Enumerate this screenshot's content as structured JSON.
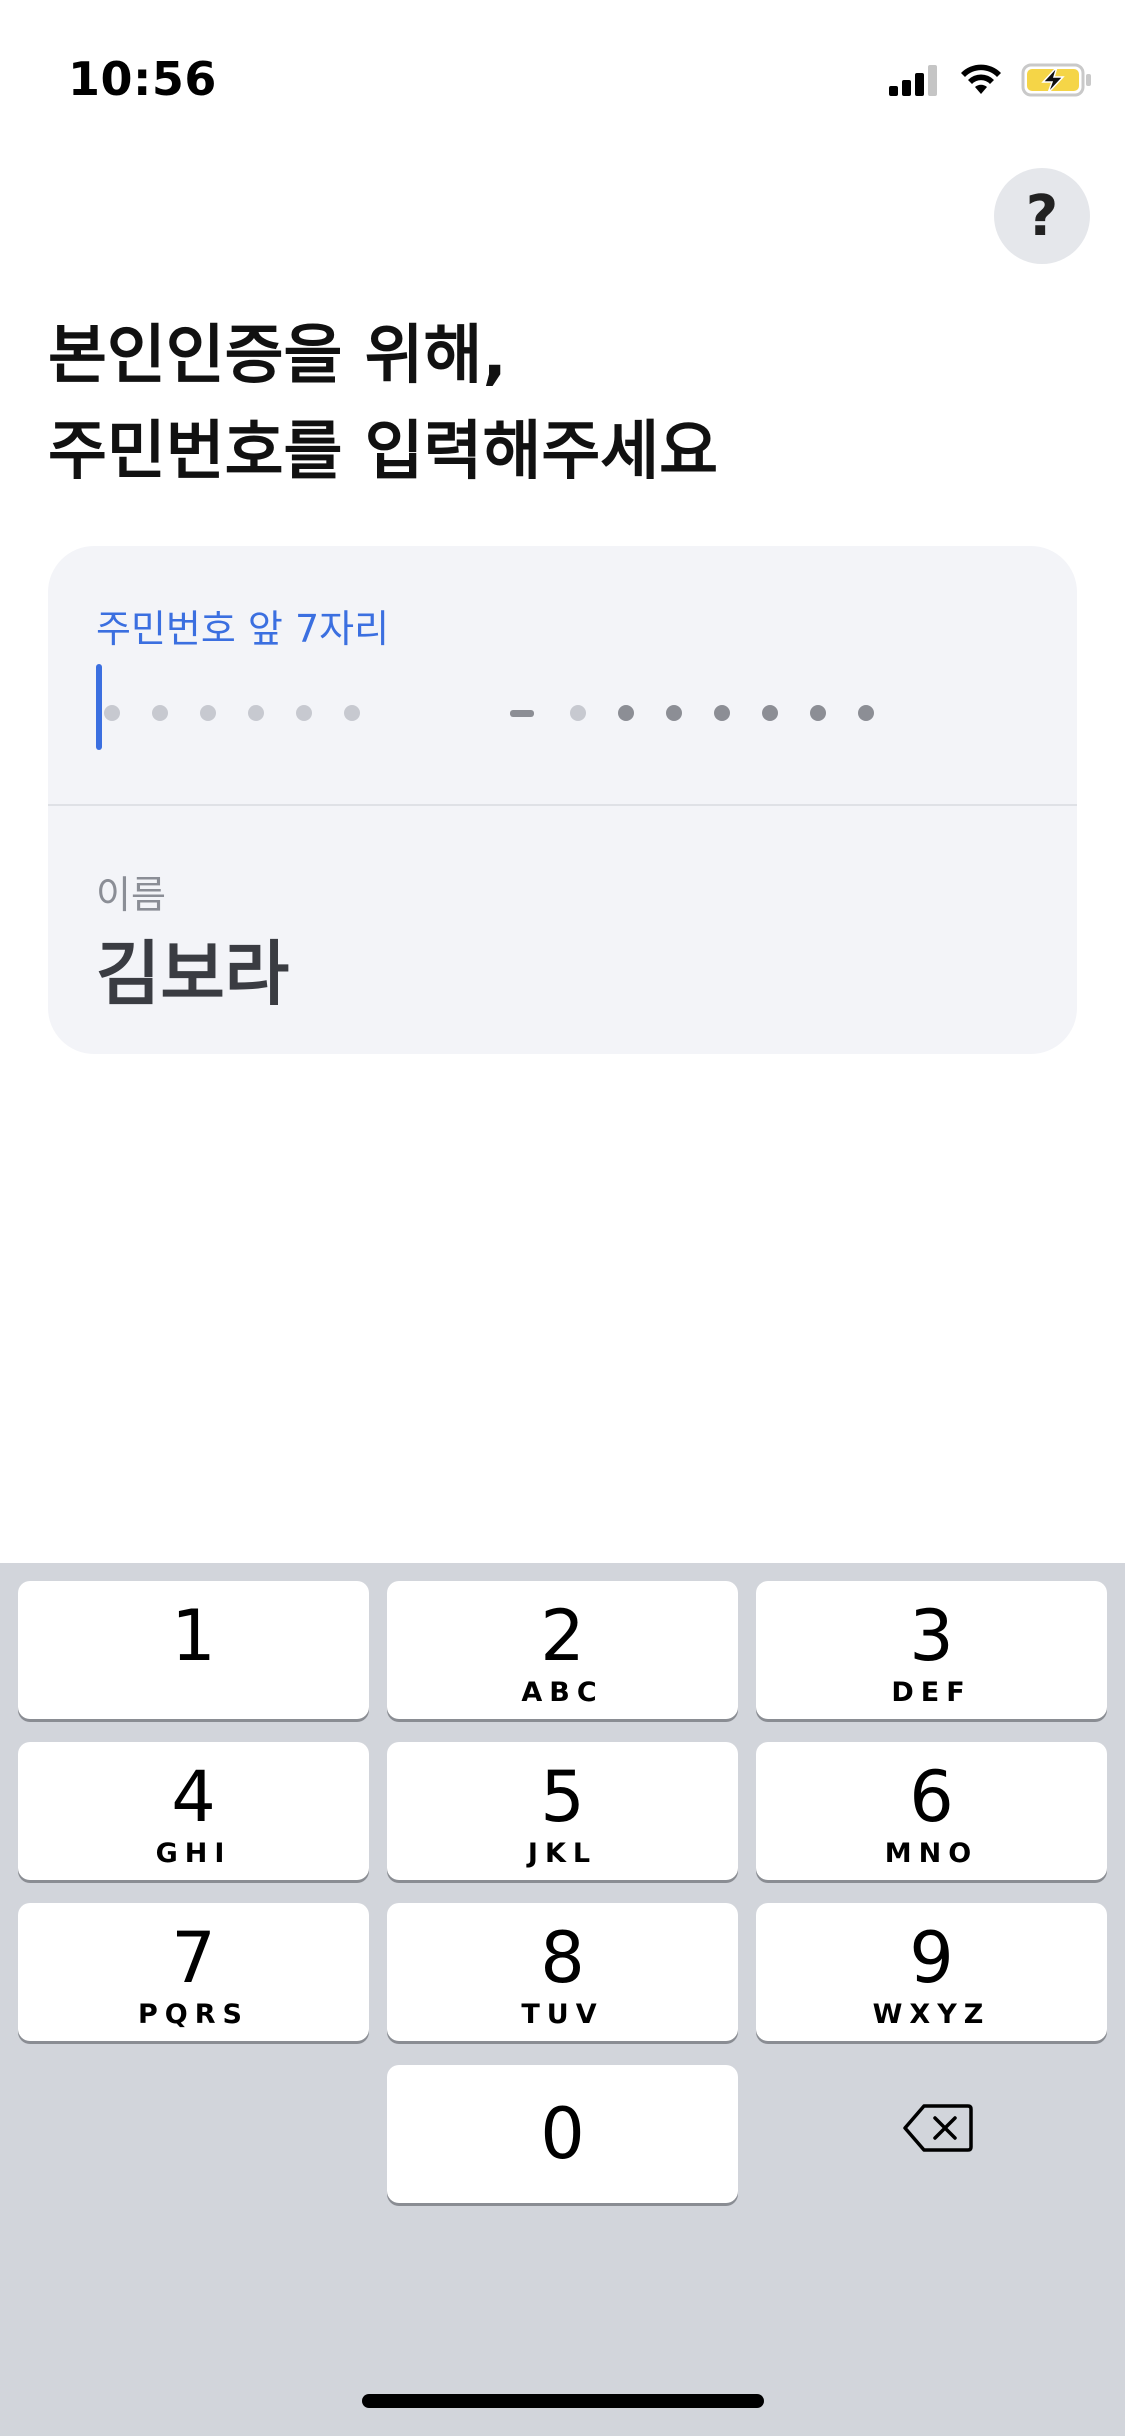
{
  "status_bar": {
    "time": "10:56",
    "icons": [
      "cellular-signal-icon",
      "wifi-icon",
      "battery-charging-icon"
    ]
  },
  "help_button": {
    "label": "?"
  },
  "title": {
    "line1": "본인인증을 위해,",
    "line2": "주민번호를 입력해주세요"
  },
  "rrn_field": {
    "label": "주민번호 앞 7자리",
    "front_digits_entered": 0,
    "front_digits_total": 6,
    "back_digits_total": 7,
    "back_digits_masked_filled": 6
  },
  "name_field": {
    "label": "이름",
    "value": "김보라"
  },
  "keyboard": {
    "keys": [
      {
        "digit": "1",
        "letters": ""
      },
      {
        "digit": "2",
        "letters": "ABC"
      },
      {
        "digit": "3",
        "letters": "DEF"
      },
      {
        "digit": "4",
        "letters": "GHI"
      },
      {
        "digit": "5",
        "letters": "JKL"
      },
      {
        "digit": "6",
        "letters": "MNO"
      },
      {
        "digit": "7",
        "letters": "PQRS"
      },
      {
        "digit": "8",
        "letters": "TUV"
      },
      {
        "digit": "9",
        "letters": "WXYZ"
      },
      {
        "digit": "0",
        "letters": ""
      }
    ],
    "backspace_icon": "backspace-icon"
  },
  "colors": {
    "accent": "#3b6fe0",
    "card_background": "#f3f4f8",
    "keyboard_background": "#d2d5db"
  }
}
